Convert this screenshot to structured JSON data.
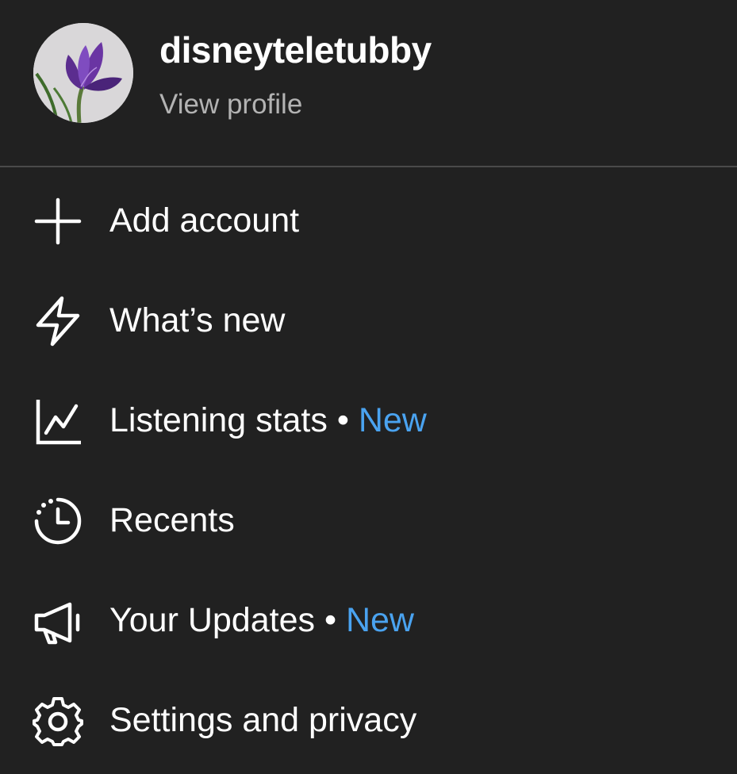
{
  "profile": {
    "username": "disneyteletubby",
    "view_profile": "View profile",
    "avatar_icon": "crocus-flower-photo"
  },
  "colors": {
    "background": "#212121",
    "text": "#ffffff",
    "secondary_text": "#b3b3b3",
    "accent_new": "#4aa3f0",
    "divider": "#4a4a4a"
  },
  "menu": {
    "items": [
      {
        "label": "Add account",
        "icon": "plus-icon"
      },
      {
        "label": "What’s new",
        "icon": "lightning-bolt-icon"
      },
      {
        "label": "Listening stats",
        "badge_sep": " • ",
        "badge": "New",
        "icon": "line-chart-icon"
      },
      {
        "label": "Recents",
        "icon": "recent-clock-icon"
      },
      {
        "label": "Your Updates",
        "badge_sep": " • ",
        "badge": "New",
        "icon": "megaphone-icon"
      },
      {
        "label": "Settings and privacy",
        "icon": "gear-icon"
      }
    ]
  }
}
